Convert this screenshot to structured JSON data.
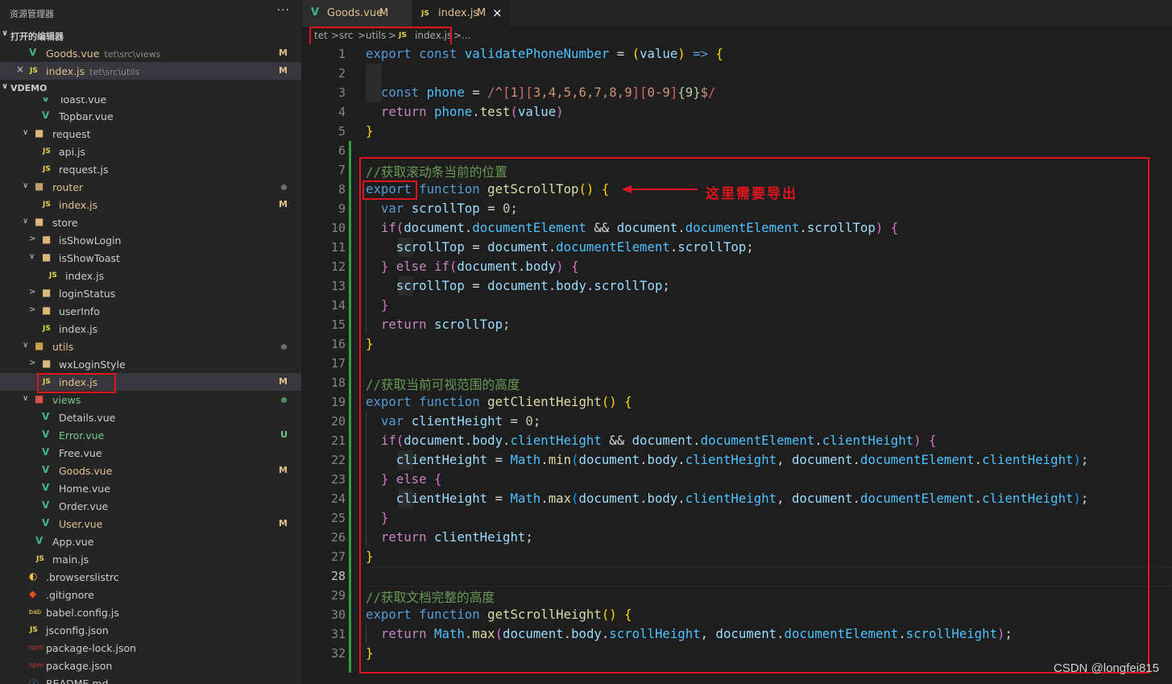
{
  "sidebar": {
    "title": "资源管理器",
    "more": "···",
    "open_editors_label": "打开的编辑器",
    "project_label": "VDEMO",
    "open_editors": [
      {
        "name": "Goods.vue",
        "path": "tet\\src\\views",
        "badge": "M",
        "icon": "vue-icon"
      },
      {
        "name": "index.js",
        "path": "tet\\src\\utils",
        "badge": "M",
        "icon": "js-icon",
        "close": "×",
        "js": "JS"
      }
    ],
    "tree": [
      {
        "name": "Toast.vue"
      },
      {
        "name": "Topbar.vue"
      },
      {
        "name": "request"
      },
      {
        "name": "api.js"
      },
      {
        "name": "request.js"
      },
      {
        "name": "router"
      },
      {
        "name": "index.js",
        "badge": "M"
      },
      {
        "name": "store"
      },
      {
        "name": "isShowLogin"
      },
      {
        "name": "isShowToast"
      },
      {
        "name": "index.js"
      },
      {
        "name": "loginStatus"
      },
      {
        "name": "userInfo"
      },
      {
        "name": "index.js"
      },
      {
        "name": "utils"
      },
      {
        "name": "wxLoginStyle"
      },
      {
        "name": "index.js",
        "badge": "M"
      },
      {
        "name": "views"
      },
      {
        "name": "Details.vue"
      },
      {
        "name": "Error.vue",
        "badge": "U"
      },
      {
        "name": "Free.vue"
      },
      {
        "name": "Goods.vue",
        "badge": "M"
      },
      {
        "name": "Home.vue"
      },
      {
        "name": "Order.vue"
      },
      {
        "name": "User.vue",
        "badge": "M"
      },
      {
        "name": "App.vue"
      },
      {
        "name": "main.js"
      },
      {
        "name": ".browserslistrc"
      },
      {
        "name": ".gitignore"
      },
      {
        "name": "babel.config.js"
      },
      {
        "name": "jsconfig.json"
      },
      {
        "name": "package-lock.json"
      },
      {
        "name": "package.json"
      },
      {
        "name": "README.md"
      }
    ]
  },
  "tabs": [
    {
      "label": "Goods.vue",
      "badge": "M"
    },
    {
      "label": "index.js",
      "badge": "M",
      "js": "JS",
      "close": "×"
    }
  ],
  "breadcrumb": {
    "parts": [
      "tet",
      "src",
      "utils",
      "index.js",
      "..."
    ],
    "sep": ">",
    "js": "JS"
  },
  "line_numbers": [
    "1",
    "2",
    "3",
    "4",
    "5",
    "6",
    "7",
    "8",
    "9",
    "10",
    "11",
    "12",
    "13",
    "14",
    "15",
    "16",
    "17",
    "18",
    "19",
    "20",
    "21",
    "22",
    "23",
    "24",
    "25",
    "26",
    "27",
    "28",
    "29",
    "30",
    "31",
    "32"
  ],
  "annotation": {
    "text": "这里需要导出"
  },
  "watermark": "CSDN @longfei815",
  "colors": {
    "accent_red": "#e0141e",
    "vue_green": "#41b883",
    "js_yellow": "#e8d44d",
    "modified": "#e2c08d"
  }
}
